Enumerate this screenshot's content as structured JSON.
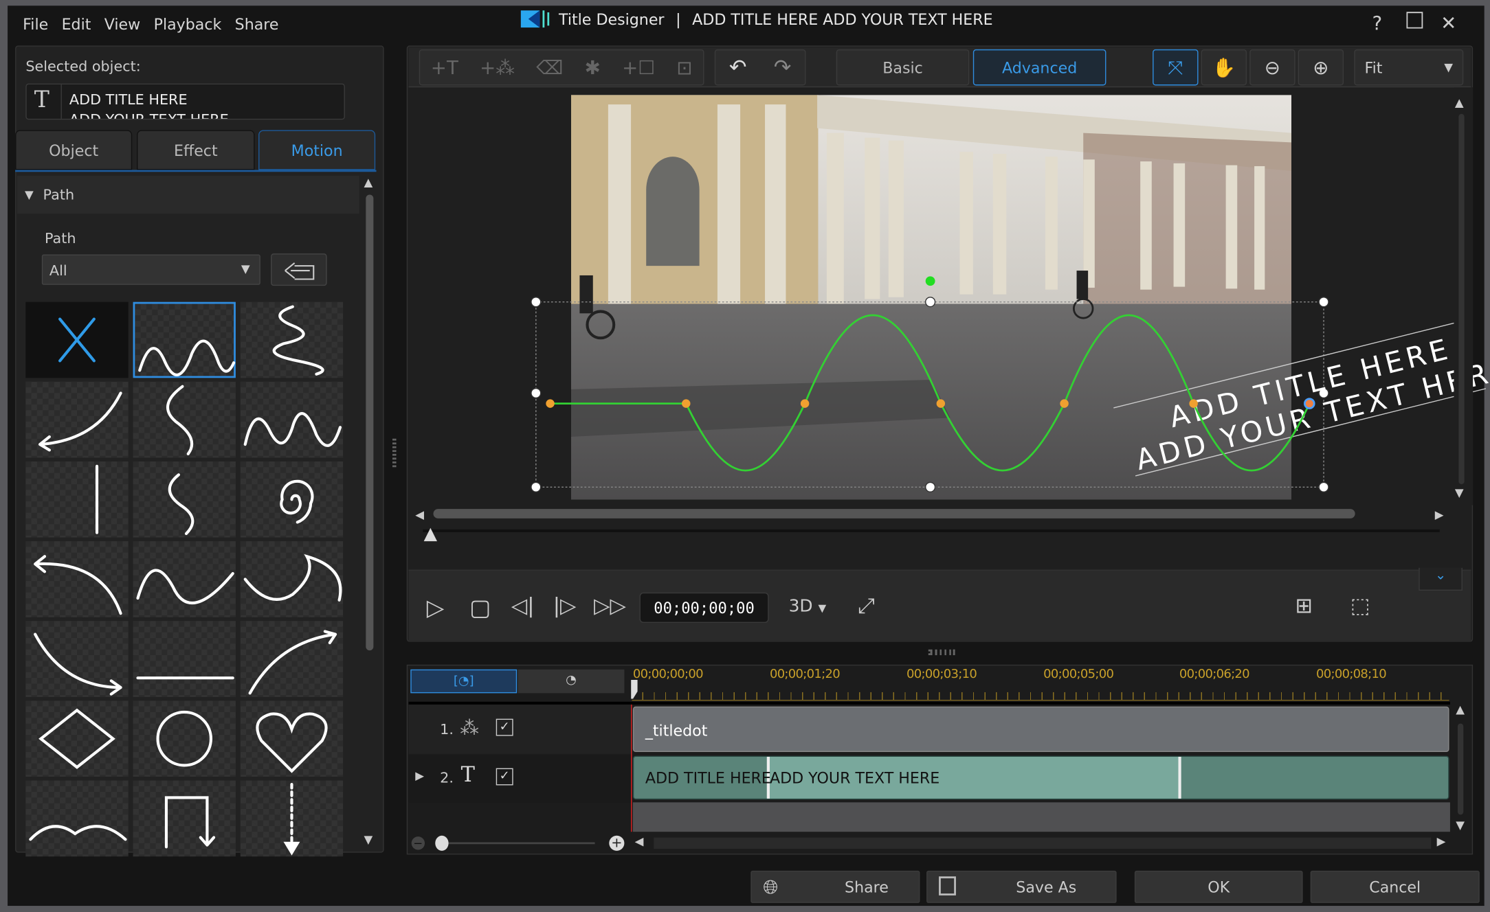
{
  "menu": {
    "items": [
      "File",
      "Edit",
      "View",
      "Playback",
      "Share"
    ]
  },
  "window": {
    "title": "Title Designer",
    "document": "ADD TITLE HERE ADD YOUR TEXT HERE",
    "help": "?",
    "maximize": "☐",
    "close": "✕"
  },
  "left_panel": {
    "selected_label": "Selected object:",
    "object_line1": "ADD TITLE HERE",
    "object_line2": "ADD YOUR TEXT HERE",
    "tabs": [
      {
        "label": "Object"
      },
      {
        "label": "Effect"
      },
      {
        "label": "Motion",
        "active": true
      }
    ],
    "section": "Path",
    "path_label": "Path",
    "path_select": "All",
    "presets": [
      "none",
      "wave",
      "squiggle",
      "curve-arrow",
      "s-curve",
      "wave-horizontal",
      "vertical-line",
      "s-small",
      "spiral",
      "arc-arrow",
      "swoop",
      "s-horizontal",
      "curve-down-arrow",
      "horizontal-line",
      "arc-up-arrow",
      "diamond",
      "circle",
      "heart",
      "double-arch",
      "square-arrow",
      "dotted-down-arrow"
    ],
    "selected_preset": "wave"
  },
  "toolbar": {
    "basic": "Basic",
    "advanced": "Advanced",
    "active_mode": "Advanced",
    "zoom": "Fit"
  },
  "preview": {
    "title_line1": "ADD TITLE HERE",
    "title_line2": "ADD YOUR TEXT HERE",
    "path_color": "#33d133",
    "keyframe_color": "#f0a030"
  },
  "playback": {
    "timecode": "00;00;00;00",
    "mode": "3D"
  },
  "timeline": {
    "ruler": [
      "00;00;00;00",
      "00;00;01;20",
      "00;00;03;10",
      "00;00;05;00",
      "00;00;06;20",
      "00;00;08;10"
    ],
    "tracks": [
      {
        "index": "1.",
        "type": "particle",
        "checked": true,
        "clip": "_titledot"
      },
      {
        "index": "2.",
        "type": "title",
        "checked": true,
        "clip_in": "ADD TITLE HERE",
        "clip_main": "ADD YOUR TEXT HERE"
      }
    ]
  },
  "buttons": {
    "share": "Share",
    "save_as": "Save As",
    "ok": "OK",
    "cancel": "Cancel"
  },
  "colors": {
    "accent": "#2f8de0",
    "ruler": "#c8a02a",
    "clip_title": "#5e8c80",
    "clip_particle": "#6b6e72"
  }
}
